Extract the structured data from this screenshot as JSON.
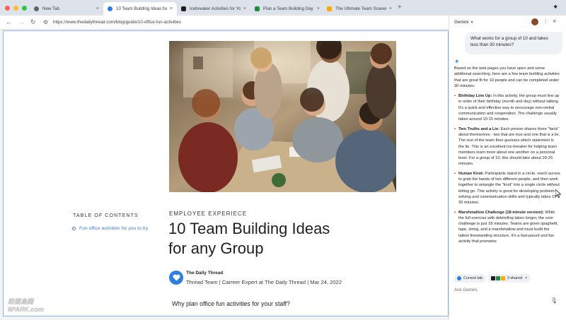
{
  "browser": {
    "tabs": [
      {
        "title": "New Tab",
        "favicon_color": "#5f6368",
        "active": false
      },
      {
        "title": "10 Team Building Ideas for a",
        "favicon_color": "#2f7fe0",
        "active": true
      },
      {
        "title": "Icebreaker Activities for Your",
        "favicon_color": "#1f1f1f",
        "active": false
      },
      {
        "title": "Plan a Team Building Day Tha",
        "favicon_color": "#1e8e3e",
        "active": false
      },
      {
        "title": "The Ultimate Team Scavenger",
        "favicon_color": "#f9ab00",
        "active": false
      }
    ],
    "new_tab_glyph": "+",
    "close_glyph": "×",
    "url": "https://www.thedailythread.com/blog/guide/10-office-fun-activities",
    "colors": {
      "close": "#ff5f57",
      "minimize": "#febc2e",
      "maximize": "#28c840",
      "accent": "#2f7fe0"
    }
  },
  "article": {
    "toc_title": "TABLE OF CONTENTS",
    "toc_items": [
      "Fun office activities for you to try"
    ],
    "kicker": "EMPLOYEE EXPERIECE",
    "title_line1": "10 Team Building Ideas",
    "title_line2": "for any Group",
    "author_name": "The Daily Thread",
    "author_meta": "Thread Team | Carreer Expert at The Daily Thread | Mar 24, 2022",
    "subheading": "Why plan office fun activities for your staff?"
  },
  "watermark": {
    "line1": "彩蛋島园",
    "line2": "6PARK.com"
  },
  "gemini": {
    "title": "Gemini",
    "user_prompt": "What works for a group of 10 and takes less than 30 minutes?",
    "intro": "Based on the web pages you have open and some additional searching, here are a few team building activities that are great fit for 10 people and can be completed under 30 minutes:",
    "items": [
      {
        "name": "Birthday Line Up:",
        "text": " In this activity, the group must line up in order of their birthday (month and day) without talking. It's a quick and effective way to encourage non-verbal communication and cooperation. The challenge usually takes around 10-15 minutes."
      },
      {
        "name": "Two Truths and a Lie:",
        "text": " Each person shares three \"facts\" about themselves - two that are true and one that is a lie. The rest of the team then guesses which statement is the lie. This is an excellent ice-breaker for helping team members learn more about one another on a personal level. For a group of 10, this should take about 20-25 minutes."
      },
      {
        "name": "Human Knot:",
        "text": " Participants stand in a circle, reach across to grab the hands of two different people, and then work together to untangle the \"knot\" into a single circle without letting go. This activity is great for developing problem-solving and communication skills and typically takes 15-20 minutes."
      },
      {
        "name": "Marshmallow Challenge (18-minute version):",
        "text": " While the full exercise with debriefing takes longer, the core challenge is just 18 minutes. Teams are given spaghetti, tape, string, and a marshmallow and must build the tallest freestanding structure. It's a fast-paced and fun activity that promotes"
      }
    ],
    "chip_current": "Current tab",
    "chip_shared": "3 shared",
    "ask_placeholder": "Ask Gemini"
  }
}
